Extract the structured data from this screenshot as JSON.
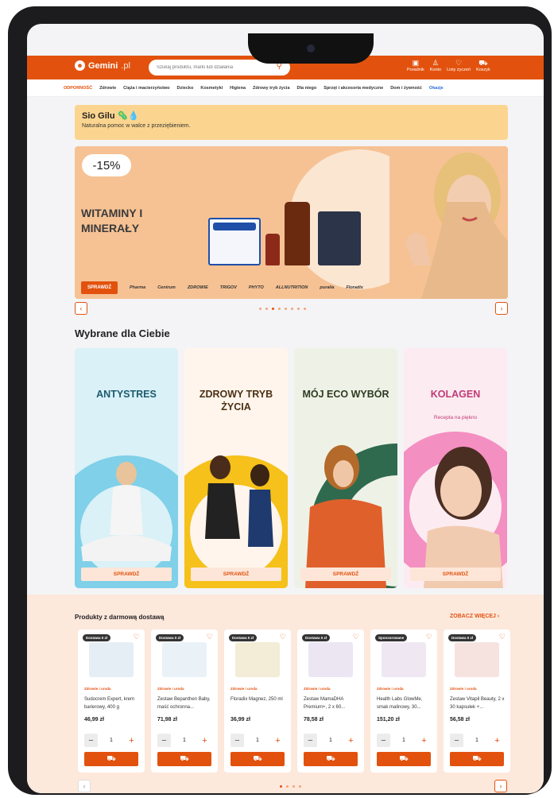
{
  "header": {
    "logo_text": "Gemini",
    "logo_suffix": ".pl",
    "search_placeholder": "Szukaj produktu, marki lub działania",
    "tools": [
      {
        "icon": "guide-icon",
        "glyph": "▣",
        "label": "Poradnik"
      },
      {
        "icon": "user-icon",
        "glyph": "♙",
        "label": "Konto"
      },
      {
        "icon": "heart-icon",
        "glyph": "♡",
        "label": "Listy życzeń"
      },
      {
        "icon": "cart-icon",
        "glyph": "⛟",
        "label": "Koszyk"
      }
    ]
  },
  "nav": [
    "ODPORNOŚĆ",
    "Zdrowie",
    "Ciąża i macierzyństwo",
    "Dziecko",
    "Kosmetyki",
    "Higiena",
    "Zdrowy tryb życia",
    "Dla niego",
    "Sprzęt i akcesoria medyczne",
    "Dom i żywność",
    "Okazje"
  ],
  "promo": {
    "title": "Sio Gilu 🦠💧",
    "subtitle": "Naturalna pomoc w walce z przeziębieniem."
  },
  "hero": {
    "badge": "-15%",
    "title": "WITAMINY I MINERAŁY",
    "button": "SPRAWDŹ",
    "brands": [
      "Pharma",
      "Centrum",
      "ZDROWIE",
      "TRIGOV",
      "PHYTO",
      "ALLNUTRITION",
      "puralia",
      "Floradix"
    ],
    "active_slide": 3,
    "slides": 8
  },
  "section_title": "Wybrane dla Ciebie",
  "categories": [
    {
      "title": "ANTYSTRES",
      "subtitle": "",
      "button": "SPRAWDŹ",
      "color": "#1e5a6e",
      "bg": "#d9f1f7",
      "arc": "#7fd0e8"
    },
    {
      "title": "ZDROWY TRYB ŻYCIA",
      "subtitle": "",
      "button": "SPRAWDŹ",
      "color": "#4a3014",
      "bg": "#fff5ec",
      "arc": "#f5c11a"
    },
    {
      "title": "MÓJ ECO WYBÓR",
      "subtitle": "",
      "button": "SPRAWDŹ",
      "color": "#2e3a22",
      "bg": "#eef2e6",
      "arc": "#2f6a4e"
    },
    {
      "title": "KOLAGEN",
      "subtitle": "Recepta na piękno",
      "button": "SPRAWDŹ",
      "color": "#c13a77",
      "bg": "#fcecf1",
      "arc": "#f48fc2"
    }
  ],
  "products_section": {
    "title": "Produkty z darmową dostawą",
    "more": "ZOBACZ WIĘCEJ",
    "items": [
      {
        "tag": "Dostawa 0 zł",
        "category": "Zdrowie i uroda",
        "name": "Sudocrem Expert, krem barierowy, 400 g",
        "price": "46,99 zł",
        "qty": "1",
        "img": "#e6eef5"
      },
      {
        "tag": "Dostawa 0 zł",
        "category": "Zdrowie i uroda",
        "name": "Zestaw Bepanthen Baby, maść ochronna...",
        "price": "71,98 zł",
        "qty": "1",
        "img": "#eaf2f8"
      },
      {
        "tag": "Dostawa 0 zł",
        "category": "Zdrowie i uroda",
        "name": "Floradix Magnez, 250 ml",
        "price": "36,99 zł",
        "qty": "1",
        "img": "#f3ecd6"
      },
      {
        "tag": "Dostawa 0 zł",
        "category": "Zdrowie i uroda",
        "name": "Zestaw MamaDHA Premium+, 2 x 60...",
        "price": "78,58 zł",
        "qty": "1",
        "img": "#ece6f3"
      },
      {
        "tag": "Sponsorowane",
        "category": "Zdrowie i uroda",
        "name": "Health Labs GlowMe, smak malinowy, 30...",
        "price": "151,20 zł",
        "qty": "1",
        "img": "#efe8f2"
      },
      {
        "tag": "Dostawa 0 zł",
        "category": "Zdrowie i uroda",
        "name": "Zestaw Vitapil Beauty, 2 x 30 kapsułek +...",
        "price": "56,58 zł",
        "qty": "1",
        "img": "#f6e3e0"
      }
    ]
  }
}
